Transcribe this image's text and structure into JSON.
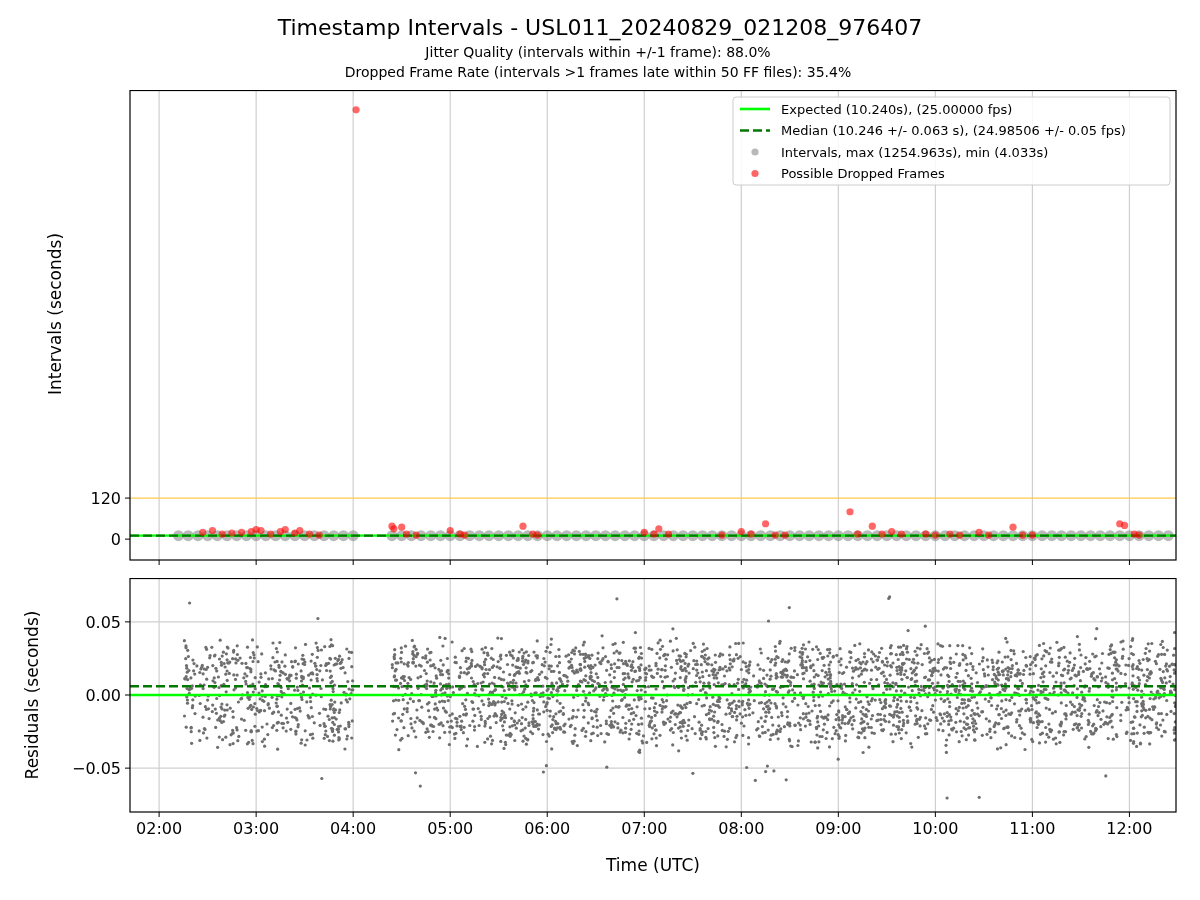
{
  "figure": {
    "title": "Timestamp Intervals - USL011_20240829_021208_976407",
    "subtitles": [
      "Jitter Quality (intervals within +/-1 frame): 88.0%",
      "Dropped Frame Rate (intervals >1 frames late within 50 FF files): 35.4%"
    ]
  },
  "intervals_chart": {
    "chart_data": {
      "type": "scatter",
      "ylabel": "Intervals (seconds)",
      "xlim": [
        1.7,
        12.48
      ],
      "ylim": [
        -61,
        1313
      ],
      "yticks": [
        {
          "value": 0,
          "label": "0"
        },
        {
          "value": 120,
          "label": "120"
        }
      ],
      "grid": "x",
      "legend": true,
      "ref_lines": [
        {
          "axis": "y",
          "value": 120,
          "color": "#ffc94d"
        },
        {
          "axis": "y",
          "value": 10.24,
          "label": "Expected (10.240s), (25.00000 fps)",
          "color": "#00ff00"
        },
        {
          "axis": "y",
          "value": 10.246,
          "label": "Median (10.246 +/- 0.063 s), (24.98506 +/- 0.05 fps)",
          "color": "#007800"
        }
      ],
      "series": [
        {
          "name": "Intervals, max (1254.963s), min (4.033s)",
          "color": "#808080",
          "x": [
            2.2,
            2.3,
            2.4,
            2.5,
            2.6,
            2.7,
            2.8,
            2.9,
            3.0,
            3.1,
            3.2,
            3.3,
            3.4,
            3.5,
            3.6,
            3.7,
            3.8,
            3.9,
            4.0,
            4.4,
            4.5,
            4.6,
            4.7,
            4.8,
            4.9,
            5.0,
            5.1,
            5.2,
            5.3,
            5.4,
            5.5,
            5.6,
            5.7,
            5.8,
            5.9,
            6.0,
            6.1,
            6.2,
            6.3,
            6.4,
            6.5,
            6.6,
            6.7,
            6.8,
            6.9,
            7.0,
            7.1,
            7.2,
            7.3,
            7.4,
            7.5,
            7.6,
            7.7,
            7.8,
            7.9,
            8.0,
            8.1,
            8.2,
            8.3,
            8.4,
            8.5,
            8.6,
            8.7,
            8.8,
            8.9,
            9.0,
            9.1,
            9.2,
            9.3,
            9.4,
            9.5,
            9.6,
            9.7,
            9.8,
            9.9,
            10.0,
            10.1,
            10.2,
            10.3,
            10.4,
            10.5,
            10.6,
            10.7,
            10.8,
            10.9,
            11.0,
            11.1,
            11.2,
            11.3,
            11.4,
            11.5,
            11.6,
            11.7,
            11.8,
            11.9,
            12.0,
            12.1,
            12.2,
            12.3,
            12.4
          ],
          "values": [
            10,
            10,
            10,
            10,
            10,
            10,
            10,
            10,
            10,
            10,
            10,
            10,
            10,
            10,
            10,
            10,
            10,
            10,
            10,
            10,
            10,
            10,
            10,
            10,
            10,
            10,
            10,
            10,
            10,
            10,
            10,
            10,
            10,
            10,
            10,
            10,
            10,
            10,
            10,
            10,
            10,
            10,
            10,
            10,
            10,
            10,
            10,
            10,
            10,
            10,
            10,
            10,
            10,
            10,
            10,
            10,
            10,
            10,
            10,
            10,
            10,
            10,
            10,
            10,
            10,
            10,
            10,
            10,
            10,
            10,
            10,
            10,
            10,
            10,
            10,
            10,
            10,
            10,
            10,
            10,
            10,
            10,
            10,
            10,
            10,
            10,
            10,
            10,
            10,
            10,
            10,
            10,
            10,
            10,
            10,
            10,
            10,
            10,
            10,
            10
          ]
        },
        {
          "name": "Possible Dropped Frames",
          "color": "#ff0000",
          "x": [
            2.45,
            2.55,
            2.65,
            2.75,
            2.85,
            2.95,
            3.0,
            3.05,
            3.15,
            3.25,
            3.3,
            3.4,
            3.45,
            3.55,
            3.65,
            4.03,
            4.4,
            4.42,
            4.5,
            4.55,
            4.65,
            5.0,
            5.1,
            5.15,
            5.75,
            5.85,
            5.9,
            7.0,
            7.1,
            7.15,
            7.25,
            7.8,
            8.0,
            8.1,
            8.25,
            8.35,
            8.45,
            9.12,
            9.2,
            9.35,
            9.45,
            9.55,
            9.65,
            9.9,
            10.0,
            10.15,
            10.25,
            10.45,
            10.55,
            10.8,
            10.9,
            11.0,
            11.9,
            11.95,
            12.05,
            12.1
          ],
          "values": [
            20,
            25,
            15,
            18,
            20,
            22,
            28,
            25,
            15,
            22,
            28,
            18,
            25,
            15,
            12,
            1255,
            38,
            30,
            35,
            15,
            12,
            25,
            15,
            12,
            38,
            15,
            12,
            20,
            15,
            30,
            15,
            12,
            22,
            15,
            45,
            12,
            12,
            80,
            15,
            38,
            15,
            22,
            15,
            15,
            12,
            15,
            12,
            20,
            12,
            35,
            12,
            12,
            45,
            40,
            15,
            12
          ]
        }
      ]
    }
  },
  "residuals_chart": {
    "chart_data": {
      "type": "scatter",
      "xlabel": "Time (UTC)",
      "ylabel": "Residuals (seconds)",
      "xlim": [
        1.7,
        12.48
      ],
      "ylim": [
        -0.08,
        0.08
      ],
      "xticks": [
        {
          "value": 2,
          "label": "02:00"
        },
        {
          "value": 3,
          "label": "03:00"
        },
        {
          "value": 4,
          "label": "04:00"
        },
        {
          "value": 5,
          "label": "05:00"
        },
        {
          "value": 6,
          "label": "06:00"
        },
        {
          "value": 7,
          "label": "07:00"
        },
        {
          "value": 8,
          "label": "08:00"
        },
        {
          "value": 9,
          "label": "09:00"
        },
        {
          "value": 10,
          "label": "10:00"
        },
        {
          "value": 11,
          "label": "11:00"
        },
        {
          "value": 12,
          "label": "12:00"
        }
      ],
      "yticks": [
        {
          "value": -0.05,
          "label": "−0.05"
        },
        {
          "value": 0,
          "label": "0.00"
        },
        {
          "value": 0.05,
          "label": "0.05"
        }
      ],
      "grid": "both",
      "ref_lines": [
        {
          "axis": "y",
          "value": 0.006,
          "color": "#007800"
        },
        {
          "axis": "y",
          "value": 0,
          "color": "#00ff00"
        }
      ]
    }
  }
}
